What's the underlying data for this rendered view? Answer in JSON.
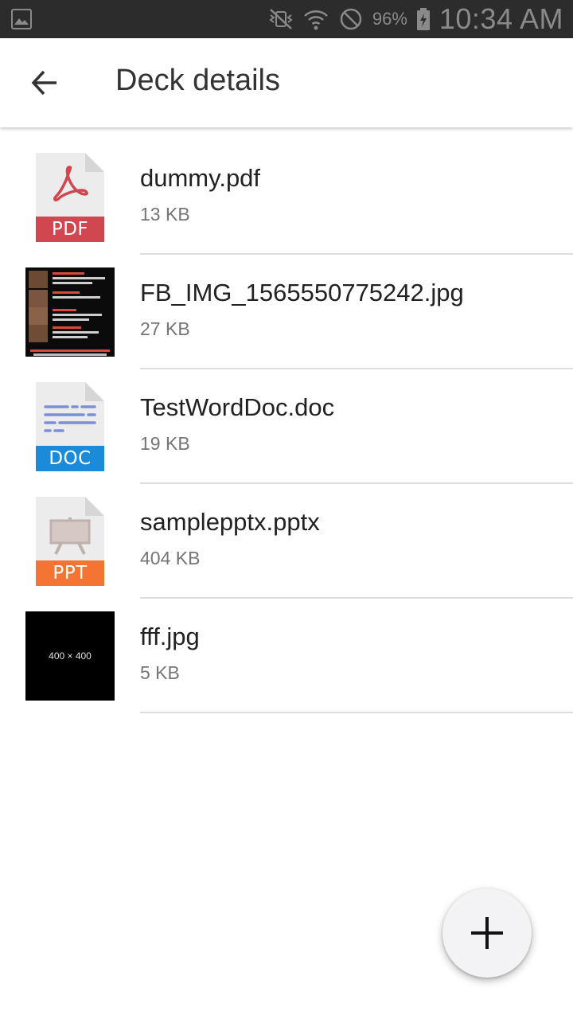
{
  "status_bar": {
    "battery_percent": "96%",
    "time": "10:34 AM",
    "icons": [
      "gallery-icon",
      "vibrate-muted-icon",
      "wifi-icon",
      "do-not-disturb-icon",
      "battery-charging-icon"
    ]
  },
  "app_bar": {
    "title": "Deck details",
    "back_icon": "arrow-back-icon"
  },
  "files": [
    {
      "name": "dummy.pdf",
      "size": "13 KB",
      "type": "pdf",
      "badge": "PDF",
      "badge_color": "#d1474f"
    },
    {
      "name": "FB_IMG_1565550775242.jpg",
      "size": "27 KB",
      "type": "image"
    },
    {
      "name": "TestWordDoc.doc",
      "size": "19 KB",
      "type": "doc",
      "badge": "DOC",
      "badge_color": "#1a8ad9"
    },
    {
      "name": "samplepptx.pptx",
      "size": "404 KB",
      "type": "ppt",
      "badge": "PPT",
      "badge_color": "#f47533"
    },
    {
      "name": "fff.jpg",
      "size": "5 KB",
      "type": "image",
      "thumb_text": "400 × 400"
    }
  ],
  "fab": {
    "icon": "plus-icon"
  }
}
